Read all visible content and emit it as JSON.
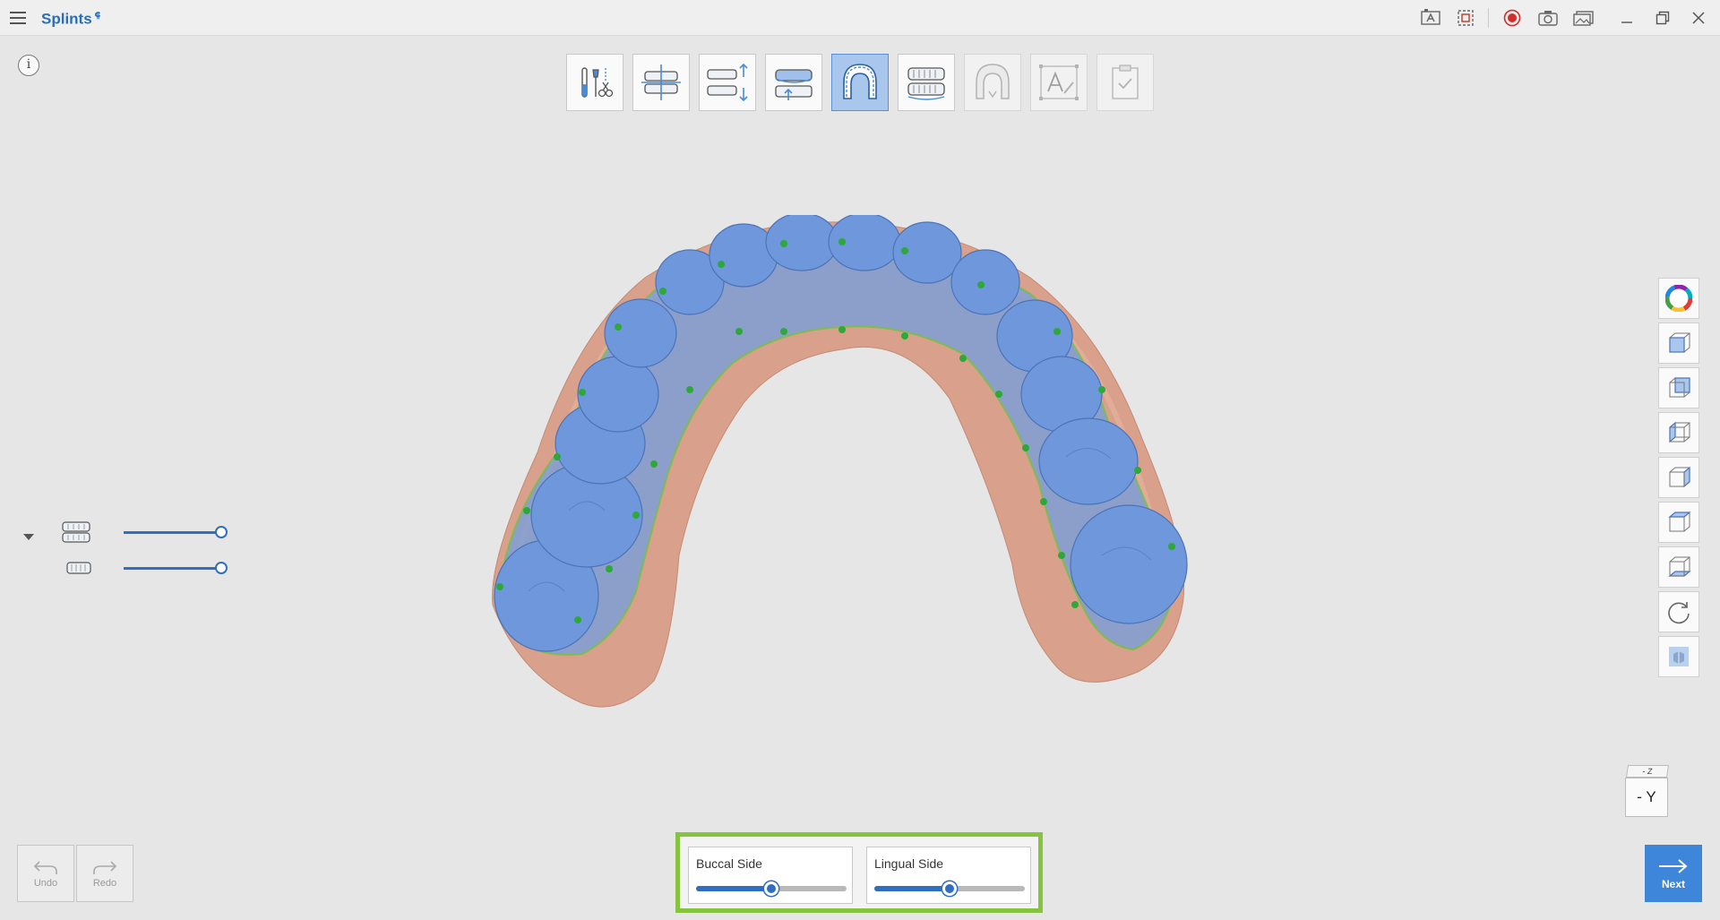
{
  "app": {
    "title": "Splints",
    "title_badge": "⸿"
  },
  "titlebar_icons": [
    "annotate-icon",
    "capture-region-icon",
    "record-icon",
    "camera-icon",
    "gallery-icon",
    "minimize-icon",
    "restore-icon",
    "close-icon"
  ],
  "info_label": "i",
  "steps": [
    {
      "name": "tools-step",
      "icon": "tools-icon",
      "state": "normal"
    },
    {
      "name": "bite-align-step",
      "icon": "bite-align-icon",
      "state": "normal"
    },
    {
      "name": "vertical-adjust-step",
      "icon": "vertical-adjust-icon",
      "state": "normal"
    },
    {
      "name": "insertion-step",
      "icon": "insertion-icon",
      "state": "normal"
    },
    {
      "name": "margin-line-step",
      "icon": "arch-outline-icon",
      "state": "active"
    },
    {
      "name": "occlusion-step",
      "icon": "occlusion-icon",
      "state": "normal"
    },
    {
      "name": "splint-design-step",
      "icon": "splint-shape-icon",
      "state": "disabled"
    },
    {
      "name": "text-label-step",
      "icon": "text-edit-icon",
      "state": "disabled"
    },
    {
      "name": "finish-step",
      "icon": "check-clipboard-icon",
      "state": "disabled"
    }
  ],
  "visibility": [
    {
      "name": "upper-jaw",
      "icon": "upper-jaw-icon",
      "opacity": 1.0
    },
    {
      "name": "lower-jaw",
      "icon": "lower-jaw-icon",
      "opacity": 1.0
    }
  ],
  "view_buttons": [
    "color-wheel-icon",
    "front-view-icon",
    "back-view-icon",
    "left-view-icon",
    "right-view-icon",
    "top-view-icon",
    "bottom-view-icon",
    "reset-rotate-icon",
    "solid-view-icon"
  ],
  "orientation": {
    "top": "- Z",
    "front": "- Y"
  },
  "undo": {
    "label": "Undo"
  },
  "redo": {
    "label": "Redo"
  },
  "next": {
    "label": "Next"
  },
  "sliders": {
    "buccal": {
      "label": "Buccal Side",
      "value": 0.5
    },
    "lingual": {
      "label": "Lingual Side",
      "value": 0.5
    }
  },
  "colors": {
    "accent": "#2f6ec0",
    "highlight": "#86c440",
    "tooth": "#6a94d8",
    "gum": "#d8a08c"
  }
}
